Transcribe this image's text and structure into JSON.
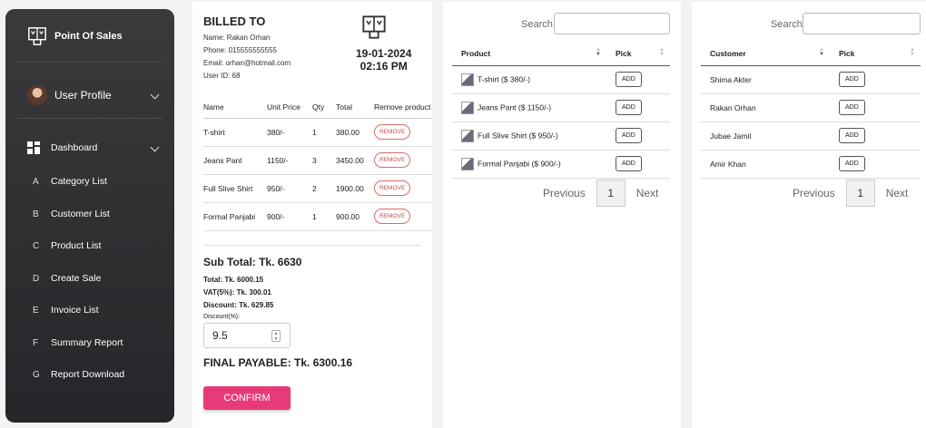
{
  "app": {
    "title": "Point Of Sales"
  },
  "profile": {
    "label": "User Profile"
  },
  "nav": {
    "dashboard": "Dashboard",
    "items": [
      {
        "letter": "A",
        "label": "Category List"
      },
      {
        "letter": "B",
        "label": "Customer List"
      },
      {
        "letter": "C",
        "label": "Product List"
      },
      {
        "letter": "D",
        "label": "Create Sale"
      },
      {
        "letter": "E",
        "label": "Invoice List"
      },
      {
        "letter": "F",
        "label": "Summary Report"
      },
      {
        "letter": "G",
        "label": "Report Download"
      }
    ]
  },
  "billing": {
    "title": "BILLED TO",
    "name": "Name: Rakan Orhan",
    "phone": "Phone: 015555555555",
    "email": "Email: orhan@hotmail.com",
    "user_id": "User ID: 68",
    "date": "19-01-2024",
    "time": "02:16 PM",
    "columns": [
      "Name",
      "Unit Price",
      "Qty",
      "Total",
      "Remove product"
    ],
    "rows": [
      {
        "name": "T-shirt",
        "unit_price": "380/-",
        "qty": "1",
        "total": "380.00"
      },
      {
        "name": "Jeans Pant",
        "unit_price": "1150/-",
        "qty": "3",
        "total": "3450.00"
      },
      {
        "name": "Full Slive Shirt",
        "unit_price": "950/-",
        "qty": "2",
        "total": "1900.00"
      },
      {
        "name": "Formal Panjabi",
        "unit_price": "900/-",
        "qty": "1",
        "total": "900.00"
      }
    ],
    "remove_label": "REMOVE",
    "subtotal": "Sub Total: Tk. 6630",
    "total": "Total: Tk. 6000.15",
    "vat": "VAT(5%): Tk. 300.01",
    "discount": "Discount: Tk. 629.85",
    "discount_label": "Discount(%):",
    "discount_value": "9.5",
    "final": "FINAL PAYABLE: Tk. 6300.16",
    "confirm_label": "CONFIRM"
  },
  "products": {
    "search_label": "Search:",
    "search_value": "",
    "columns": [
      "Product",
      "Pick"
    ],
    "rows": [
      {
        "label": "T-shirt ($ 380/-)"
      },
      {
        "label": "Jeans Pant ($ 1150/-)"
      },
      {
        "label": "Full Slive Shirt ($ 950/-)"
      },
      {
        "label": "Formal Panjabi ($ 900/-)"
      }
    ],
    "add_label": "ADD",
    "prev_label": "Previous",
    "page": "1",
    "next_label": "Next"
  },
  "customers": {
    "search_label": "Search:",
    "search_value": "",
    "columns": [
      "Customer",
      "Pick"
    ],
    "rows": [
      {
        "label": "Shima Akter"
      },
      {
        "label": "Rakan Orhan"
      },
      {
        "label": "Jubae Jamil"
      },
      {
        "label": "Amir Khan"
      }
    ],
    "add_label": "ADD",
    "prev_label": "Previous",
    "page": "1",
    "next_label": "Next"
  },
  "colors": {
    "accent": "#e83a78",
    "remove": "#e06a6a",
    "sidebar_top": "#3a3a3c",
    "sidebar_bottom": "#26262a"
  },
  "icons": [
    "pos-logo-icon",
    "avatar",
    "dashboard-grid-icon",
    "chevron-down-icon",
    "sort-icon"
  ]
}
